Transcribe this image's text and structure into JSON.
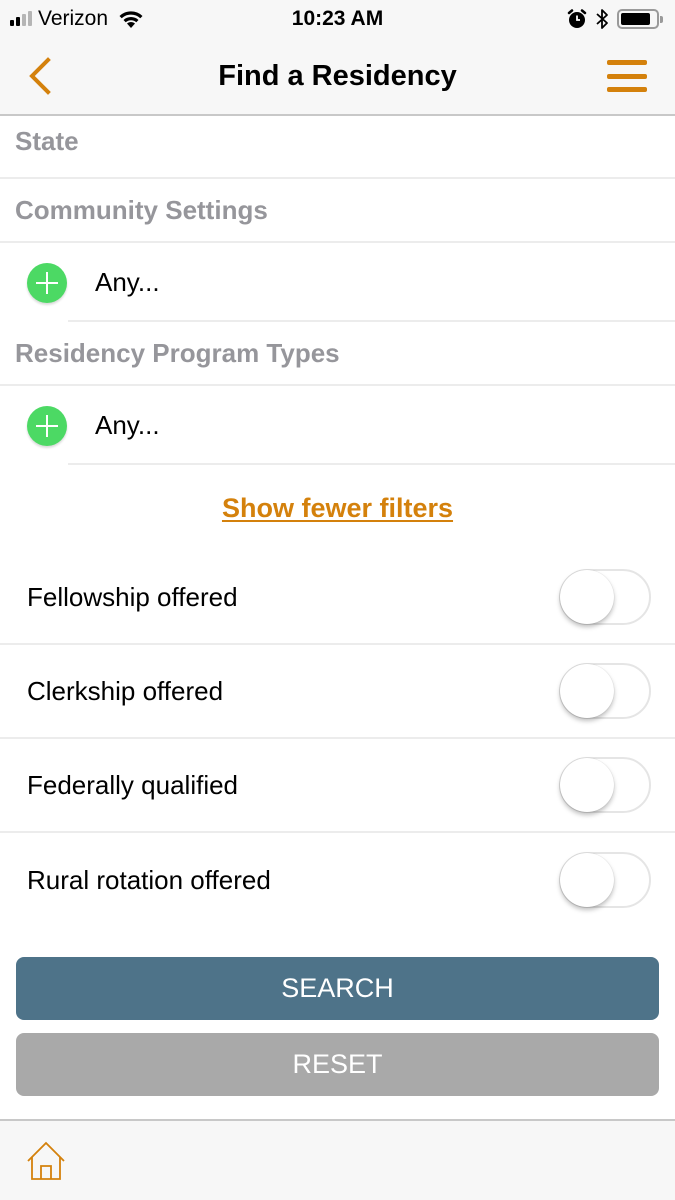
{
  "status_bar": {
    "carrier": "Verizon",
    "signal_bars_active": 2,
    "signal_bars_total": 4,
    "time": "10:23 AM",
    "battery_level": 0.85,
    "icons": [
      "signal-icon",
      "wifi-icon",
      "alarm-icon",
      "bluetooth-icon",
      "battery-icon"
    ]
  },
  "nav": {
    "title": "Find a Residency",
    "back_icon": "chevron-left-icon",
    "menu_icon": "hamburger-menu-icon",
    "accent_color": "#d4810c"
  },
  "filters": {
    "state_label": "State",
    "community_settings": {
      "label": "Community Settings",
      "value": "Any..."
    },
    "program_types": {
      "label": "Residency Program Types",
      "value": "Any..."
    },
    "toggle_filters_link": "Show fewer filters",
    "switches": [
      {
        "label": "Fellowship offered",
        "on": false
      },
      {
        "label": "Clerkship offered",
        "on": false
      },
      {
        "label": "Federally qualified",
        "on": false
      },
      {
        "label": "Rural rotation offered",
        "on": false
      }
    ]
  },
  "actions": {
    "search_label": "SEARCH",
    "reset_label": "RESET",
    "search_color": "#4e7389",
    "reset_color": "#a9a9a9"
  },
  "tab_bar": {
    "home_icon": "home-icon"
  }
}
